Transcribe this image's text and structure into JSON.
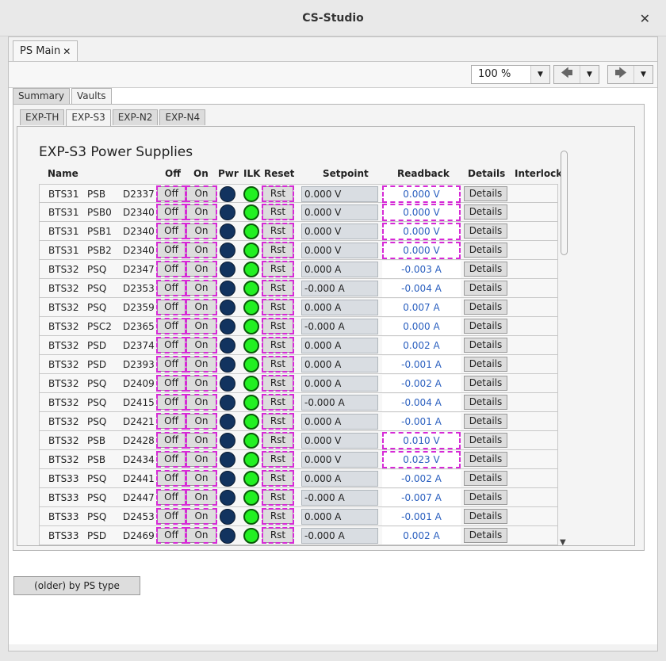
{
  "window": {
    "title": "CS-Studio",
    "close_glyph": "✕"
  },
  "doc_tab": {
    "label": "PS Main",
    "close_glyph": "✕"
  },
  "toolbar": {
    "zoom": "100 %",
    "back_glyph": "🡄",
    "forward_glyph": "🡆",
    "drop_glyph": "▼"
  },
  "outer_tabs": [
    "Summary",
    "Vaults"
  ],
  "inner_tabs": [
    "EXP-TH",
    "EXP-S3",
    "EXP-N2",
    "EXP-N4"
  ],
  "panel_title": "EXP-S3 Power Supplies",
  "headers": {
    "name": "Name",
    "off": "Off",
    "on": "On",
    "pwr": "Pwr",
    "ilk": "ILK",
    "reset": "Reset",
    "setpoint": "Setpoint",
    "readback": "Readback",
    "details": "Details",
    "interlocks": "Interlocks"
  },
  "labels": {
    "off": "Off",
    "on": "On",
    "rst": "Rst",
    "details": "Details"
  },
  "rows": [
    {
      "a": "BTS31",
      "b": "PSB",
      "c": "D2337",
      "setpoint": "0.000 V",
      "readback": "0.000 V",
      "flag": true
    },
    {
      "a": "BTS31",
      "b": "PSB0",
      "c": "D2340",
      "setpoint": "0.000 V",
      "readback": "0.000 V",
      "flag": true
    },
    {
      "a": "BTS31",
      "b": "PSB1",
      "c": "D2340",
      "setpoint": "0.000 V",
      "readback": "0.000 V",
      "flag": true
    },
    {
      "a": "BTS31",
      "b": "PSB2",
      "c": "D2340",
      "setpoint": "0.000 V",
      "readback": "0.000 V",
      "flag": true
    },
    {
      "a": "BTS32",
      "b": "PSQ",
      "c": "D2347",
      "setpoint": "0.000 A",
      "readback": "-0.003 A",
      "flag": false
    },
    {
      "a": "BTS32",
      "b": "PSQ",
      "c": "D2353",
      "setpoint": "-0.000 A",
      "readback": "-0.004 A",
      "flag": false
    },
    {
      "a": "BTS32",
      "b": "PSQ",
      "c": "D2359",
      "setpoint": "0.000 A",
      "readback": "0.007 A",
      "flag": false
    },
    {
      "a": "BTS32",
      "b": "PSC2",
      "c": "D2365",
      "setpoint": "-0.000 A",
      "readback": "0.000 A",
      "flag": false
    },
    {
      "a": "BTS32",
      "b": "PSD",
      "c": "D2374",
      "setpoint": "0.000 A",
      "readback": "0.002 A",
      "flag": false
    },
    {
      "a": "BTS32",
      "b": "PSD",
      "c": "D2393",
      "setpoint": "0.000 A",
      "readback": "-0.001 A",
      "flag": false
    },
    {
      "a": "BTS32",
      "b": "PSQ",
      "c": "D2409",
      "setpoint": "0.000 A",
      "readback": "-0.002 A",
      "flag": false
    },
    {
      "a": "BTS32",
      "b": "PSQ",
      "c": "D2415",
      "setpoint": "-0.000 A",
      "readback": "-0.004 A",
      "flag": false
    },
    {
      "a": "BTS32",
      "b": "PSQ",
      "c": "D2421",
      "setpoint": "0.000 A",
      "readback": "-0.001 A",
      "flag": false
    },
    {
      "a": "BTS32",
      "b": "PSB",
      "c": "D2428",
      "setpoint": "0.000 V",
      "readback": "0.010 V",
      "flag": true
    },
    {
      "a": "BTS32",
      "b": "PSB",
      "c": "D2434",
      "setpoint": "0.000 V",
      "readback": "0.023 V",
      "flag": true
    },
    {
      "a": "BTS33",
      "b": "PSQ",
      "c": "D2441",
      "setpoint": "0.000 A",
      "readback": "-0.002 A",
      "flag": false
    },
    {
      "a": "BTS33",
      "b": "PSQ",
      "c": "D2447",
      "setpoint": "-0.000 A",
      "readback": "-0.007 A",
      "flag": false
    },
    {
      "a": "BTS33",
      "b": "PSQ",
      "c": "D2453",
      "setpoint": "0.000 A",
      "readback": "-0.001 A",
      "flag": false
    },
    {
      "a": "BTS33",
      "b": "PSD",
      "c": "D2469",
      "setpoint": "-0.000 A",
      "readback": "0.002 A",
      "flag": false
    }
  ],
  "older_button": "(older) by PS type",
  "colors": {
    "flag_outline": "#d62ad6",
    "readback_text": "#2a5fbf",
    "led_on": "#22f022",
    "led_off": "#12335f"
  }
}
